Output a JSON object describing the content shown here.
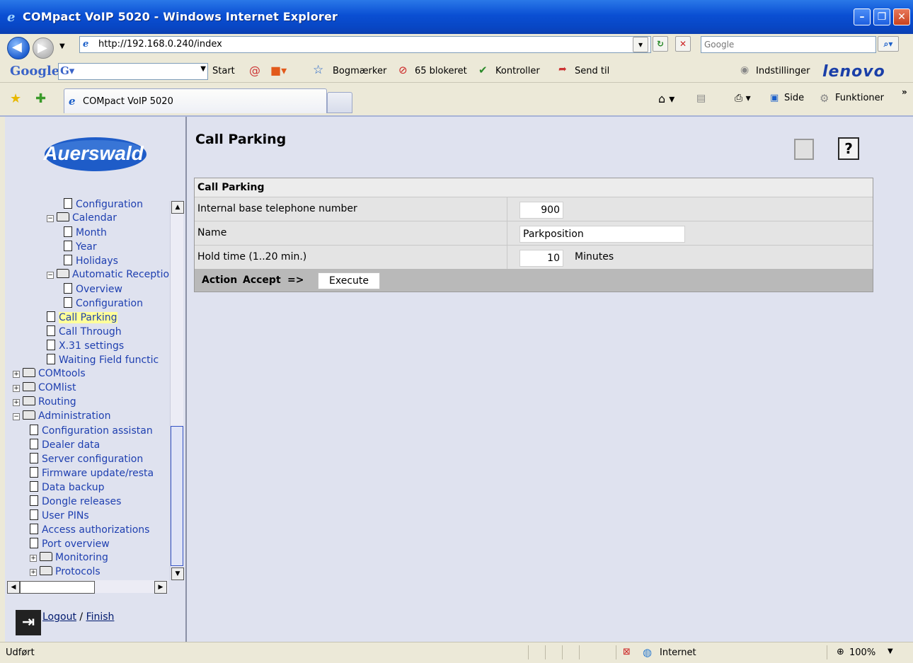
{
  "window": {
    "title": "COMpact VoIP 5020 - Windows Internet Explorer",
    "controls": [
      "minimize",
      "maximize",
      "close"
    ]
  },
  "address_bar": {
    "url": "http://192.168.0.240/index",
    "search_placeholder": "Google"
  },
  "google_toolbar": {
    "logo": "Google",
    "start_label": "Start",
    "bookmarks_label": "Bogmærker",
    "blocked_label": "65 blokeret",
    "check_label": "Kontroller",
    "send_label": "Send til",
    "settings_label": "Indstillinger",
    "brand": "lenovo"
  },
  "tab_bar": {
    "active_tab": "COMpact VoIP 5020",
    "page_menu": "Side",
    "tools_menu": "Funktioner"
  },
  "sidebar": {
    "logo_text": "Auerswald",
    "tree": [
      {
        "label": "Configuration",
        "kind": "doc",
        "indent": 3
      },
      {
        "label": "Calendar",
        "kind": "folder-open",
        "indent": 2
      },
      {
        "label": "Month",
        "kind": "doc",
        "indent": 3
      },
      {
        "label": "Year",
        "kind": "doc",
        "indent": 3
      },
      {
        "label": "Holidays",
        "kind": "doc",
        "indent": 3
      },
      {
        "label": "Automatic Receptio",
        "kind": "folder-open",
        "indent": 2
      },
      {
        "label": "Overview",
        "kind": "doc",
        "indent": 3
      },
      {
        "label": "Configuration",
        "kind": "doc",
        "indent": 3
      },
      {
        "label": "Call Parking",
        "kind": "doc",
        "indent": 2,
        "selected": true
      },
      {
        "label": "Call Through",
        "kind": "doc",
        "indent": 2
      },
      {
        "label": "X.31 settings",
        "kind": "doc",
        "indent": 2
      },
      {
        "label": "Waiting Field functic",
        "kind": "doc",
        "indent": 2
      },
      {
        "label": "COMtools",
        "kind": "folder",
        "indent": 0
      },
      {
        "label": "COMlist",
        "kind": "folder",
        "indent": 0
      },
      {
        "label": "Routing",
        "kind": "folder",
        "indent": 0
      },
      {
        "label": "Administration",
        "kind": "folder-open",
        "indent": 0
      },
      {
        "label": "Configuration assistan",
        "kind": "doc",
        "indent": 1
      },
      {
        "label": "Dealer data",
        "kind": "doc",
        "indent": 1
      },
      {
        "label": "Server configuration",
        "kind": "doc",
        "indent": 1
      },
      {
        "label": "Firmware update/resta",
        "kind": "doc",
        "indent": 1
      },
      {
        "label": "Data backup",
        "kind": "doc",
        "indent": 1
      },
      {
        "label": "Dongle releases",
        "kind": "doc",
        "indent": 1
      },
      {
        "label": "User PINs",
        "kind": "doc",
        "indent": 1
      },
      {
        "label": "Access authorizations",
        "kind": "doc",
        "indent": 1
      },
      {
        "label": "Port overview",
        "kind": "doc",
        "indent": 1
      },
      {
        "label": "Monitoring",
        "kind": "folder",
        "indent": 1
      },
      {
        "label": "Protocols",
        "kind": "folder",
        "indent": 1
      }
    ],
    "logout_label": "Logout",
    "finish_label": "Finish"
  },
  "main": {
    "title": "Call Parking",
    "section_header": "Call Parking",
    "rows": [
      {
        "label": "Internal base telephone number",
        "value": "900"
      },
      {
        "label": "Name",
        "value": "Parkposition"
      },
      {
        "label": "Hold time (1..20 min.)",
        "value": "10",
        "unit": "Minutes"
      }
    ],
    "action": {
      "label": "Action",
      "selected": "Accept",
      "arrow": "=>",
      "button": "Execute"
    }
  },
  "status_bar": {
    "status": "Udført",
    "zone": "Internet",
    "zoom": "100%"
  },
  "colors": {
    "title_bar": "#0a4fd3",
    "content_bg": "#dfe2ef",
    "tree_link": "#1e3fb0",
    "selection": "#ffff99"
  }
}
